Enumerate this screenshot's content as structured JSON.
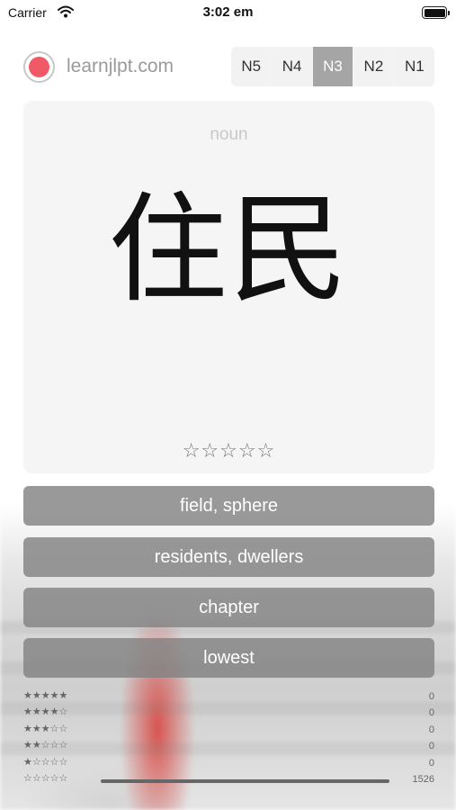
{
  "status_bar": {
    "carrier": "Carrier",
    "time": "3:02 em",
    "wifi_icon": "wifi-icon",
    "battery_icon": "battery-icon"
  },
  "header": {
    "site_name": "learnjlpt.com",
    "logo_color": "#f05a66",
    "levels": [
      "N5",
      "N4",
      "N3",
      "N2",
      "N1"
    ],
    "active_level": "N3"
  },
  "card": {
    "part_of_speech": "noun",
    "word": "住民",
    "rating_display": "☆☆☆☆☆"
  },
  "answers": [
    "field, sphere",
    "residents, dwellers",
    "chapter",
    "lowest"
  ],
  "stats": [
    {
      "stars": "★★★★★",
      "count": "0",
      "fraction": 0
    },
    {
      "stars": "★★★★☆",
      "count": "0",
      "fraction": 0
    },
    {
      "stars": "★★★☆☆",
      "count": "0",
      "fraction": 0
    },
    {
      "stars": "★★☆☆☆",
      "count": "0",
      "fraction": 0
    },
    {
      "stars": "★☆☆☆☆",
      "count": "0",
      "fraction": 0
    },
    {
      "stars": "☆☆☆☆☆",
      "count": "1526",
      "fraction": 1
    }
  ],
  "colors": {
    "accent_tab": "#a5a5a5",
    "answer_button": "#828282"
  }
}
